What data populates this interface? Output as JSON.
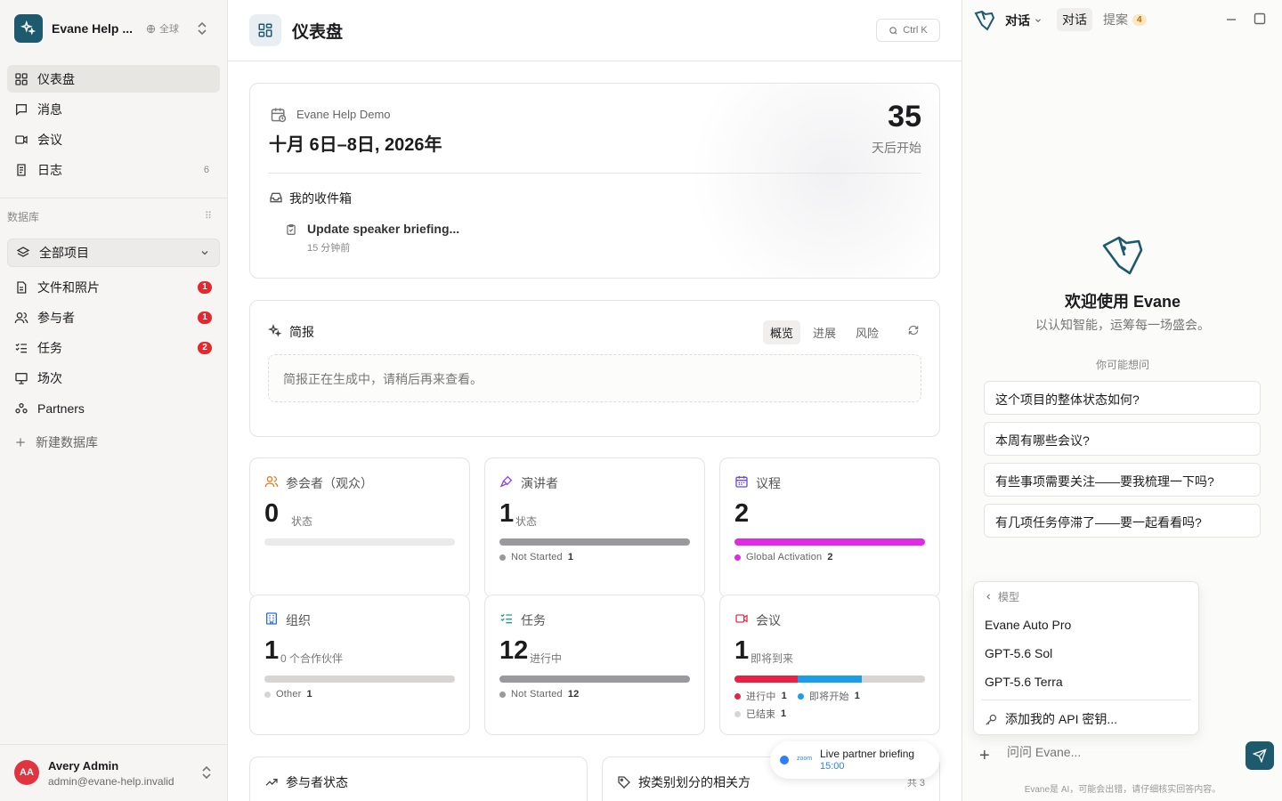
{
  "workspace": {
    "name": "Evane Help ...",
    "scope": "全球"
  },
  "nav": [
    {
      "label": "仪表盘",
      "active": true
    },
    {
      "label": "消息"
    },
    {
      "label": "会议"
    },
    {
      "label": "日志",
      "count": "6"
    }
  ],
  "database": {
    "title": "数据库",
    "all_projects": "全部项目",
    "items": [
      {
        "label": "文件和照片",
        "badge": "1"
      },
      {
        "label": "参与者",
        "badge": "1"
      },
      {
        "label": "任务",
        "badge": "2"
      },
      {
        "label": "场次"
      },
      {
        "label": "Partners"
      }
    ],
    "new_db": "新建数据库"
  },
  "user": {
    "initials": "AA",
    "name": "Avery Admin",
    "email": "admin@evane-help.invalid"
  },
  "header": {
    "title": "仪表盘",
    "shortcut": "Ctrl K"
  },
  "event": {
    "name": "Evane Help Demo",
    "dates": "十月 6日–8日, 2026年",
    "days": "35",
    "days_label": "天后开始",
    "inbox_title": "我的收件箱",
    "inbox_item": "Update speaker briefing...",
    "inbox_time": "15 分钟前"
  },
  "briefing": {
    "title": "简报",
    "tabs": [
      "概览",
      "进展",
      "风险"
    ],
    "message": "简报正在生成中，请稍后再来查看。"
  },
  "stats": {
    "attendees": {
      "title": "参会者（观众）",
      "value": "0",
      "sub": "状态"
    },
    "speakers": {
      "title": "演讲者",
      "value": "1",
      "sub": "状态",
      "legend": "Not Started",
      "legend_count": "1"
    },
    "agenda": {
      "title": "议程",
      "value": "2",
      "legend": "Global Activation",
      "legend_count": "2"
    },
    "orgs": {
      "title": "组织",
      "value": "1",
      "sub": "0 个合作伙伴",
      "legend": "Other",
      "legend_count": "1"
    },
    "tasks": {
      "title": "任务",
      "value": "12",
      "sub": "进行中",
      "legend": "Not Started",
      "legend_count": "12"
    },
    "meetings": {
      "title": "会议",
      "value": "1",
      "sub": "即将到来",
      "legend_a": "进行中",
      "legend_a_count": "1",
      "legend_b": "即将开始",
      "legend_b_count": "1",
      "legend_c": "已结束",
      "legend_c_count": "1"
    }
  },
  "bottom": {
    "left_title": "参与者状态",
    "right_title": "按类别划分的相关方",
    "right_meta": "共 3"
  },
  "toast": {
    "brand": "zoom",
    "title": "Live partner briefing",
    "time": "15:00"
  },
  "panel": {
    "selector": "对话",
    "tabs": [
      "对话",
      "提案"
    ],
    "proposals_count": "4",
    "welcome": "欢迎使用 Evane",
    "tagline": "以认知智能，运筹每一场盛会。",
    "maybe": "你可能想问",
    "suggestions": [
      "这个项目的整体状态如何?",
      "本周有哪些会议?",
      "有些事项需要关注——要我梳理一下吗?",
      "有几项任务停滞了——要一起看看吗?"
    ],
    "model_menu": {
      "back": "模型",
      "models": [
        "Evane Auto Pro",
        "GPT-5.6 Sol",
        "GPT-5.6 Terra"
      ],
      "api": "添加我的 API 密钥..."
    },
    "placeholder": "问问 Evane...",
    "disclaimer": "Evane是 AI，可能会出错，请仔细核实回答内容。"
  },
  "colors": {
    "brand": "#1d5a6d",
    "badge": "#e5282e",
    "speakers_bar": "#9a999e",
    "agenda_bar": "#e02ae3",
    "meetings_in_progress": "#ea2146",
    "meetings_upcoming": "#1b9de8",
    "meetings_ended": "#d6d5d3"
  }
}
